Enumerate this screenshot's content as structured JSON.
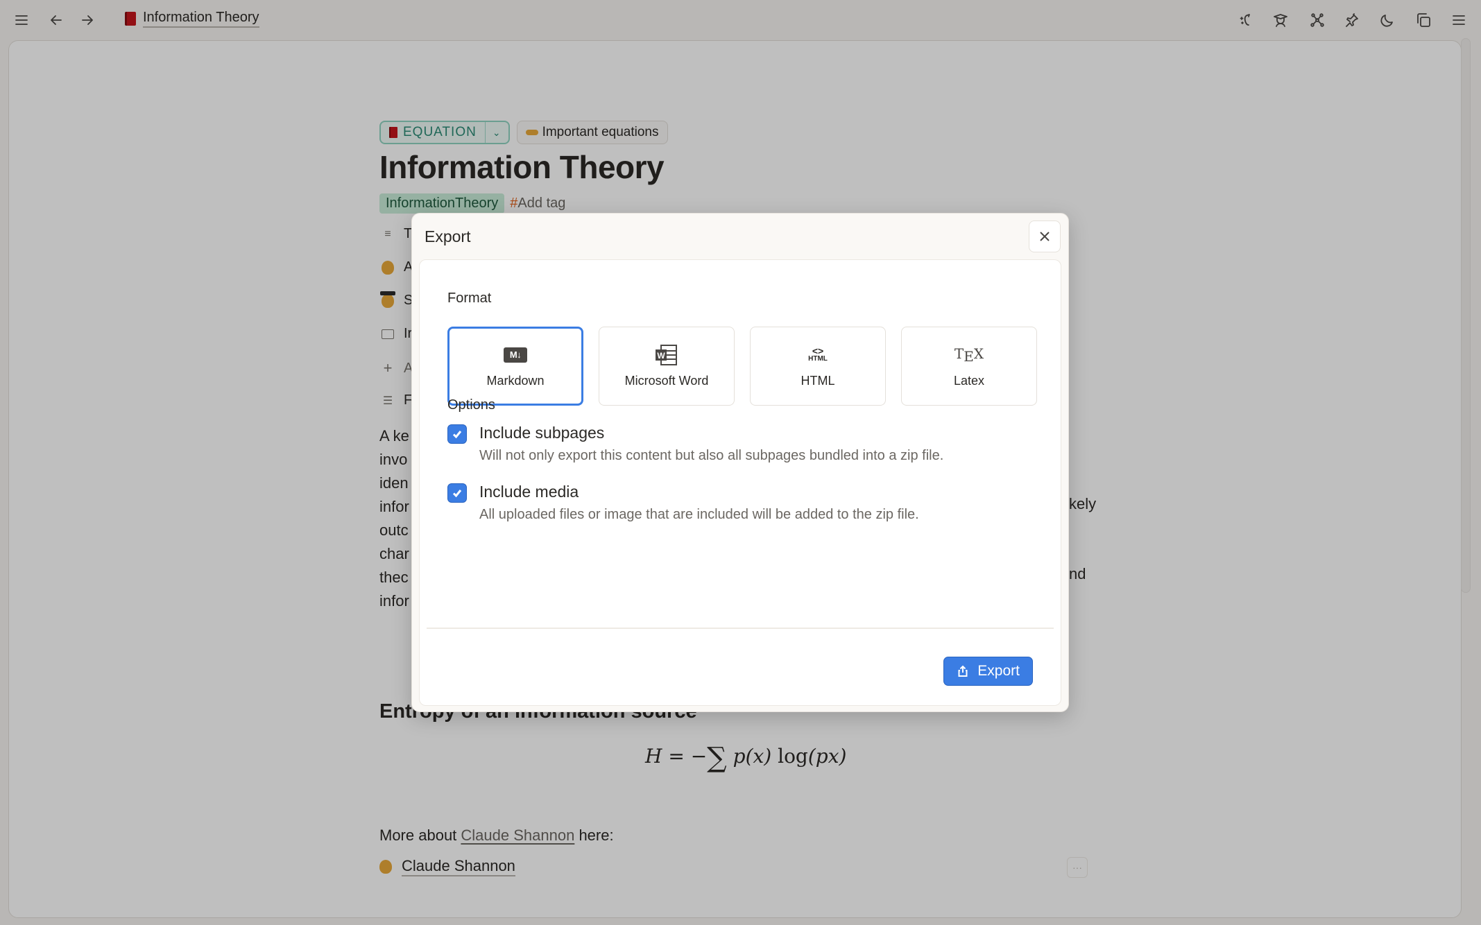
{
  "topbar": {
    "breadcrumb_title": "Information Theory",
    "icons": [
      "menu-icon",
      "back-arrow-icon",
      "forward-arrow-icon",
      "ai-sparkle-icon",
      "student-icon",
      "graph-icon",
      "pin-icon",
      "dark-mode-moon-icon",
      "duplicate-window-icon",
      "more-menu-icon"
    ]
  },
  "document": {
    "type_badge": "EQUATION",
    "collection_badge": "Important equations",
    "title": "Information Theory",
    "tags": [
      "InformationTheory"
    ],
    "add_tag_label": "Add tag",
    "properties": [
      {
        "icon": "text-icon",
        "label_visible": "T"
      },
      {
        "icon": "person-emoji",
        "label_visible": "A"
      },
      {
        "icon": "student-emoji",
        "label_visible": "S"
      },
      {
        "icon": "image-icon",
        "label_visible": "Ir"
      },
      {
        "icon": "plus-icon",
        "label_visible": "A"
      },
      {
        "icon": "list-icon",
        "label_visible": "F"
      }
    ],
    "paragraph_lines_visible": [
      "A ke",
      "invo",
      "iden",
      "infor",
      "outc",
      "char",
      "thec",
      "infor"
    ],
    "paragraph_tail_fragments": [
      "kely",
      "nd"
    ],
    "section_heading": "Entropy of an information source",
    "equation": {
      "lhs": "H",
      "eq": "=",
      "minus": "−",
      "sum": "∑",
      "p_x": "p(x)",
      "log": "log",
      "arg": "(px)"
    },
    "more_prefix": "More about ",
    "more_link": "Claude Shannon",
    "more_suffix": " here:",
    "page_ref": "Claude Shannon",
    "more_dots": "···"
  },
  "dialog": {
    "title": "Export",
    "format_label": "Format",
    "formats": [
      {
        "name": "Markdown",
        "icon_text": "M↓",
        "selected": true
      },
      {
        "name": "Microsoft Word",
        "icon_text": "W",
        "selected": false
      },
      {
        "name": "HTML",
        "icon_text": "HTML",
        "selected": false
      },
      {
        "name": "Latex",
        "icon_text": "TEX",
        "selected": false
      }
    ],
    "options_label": "Options",
    "options": [
      {
        "title": "Include subpages",
        "description": "Will not only export this content but also all subpages bundled into a zip file.",
        "checked": true
      },
      {
        "title": "Include media",
        "description": "All uploaded files or image that are included will be added to the zip file.",
        "checked": true
      }
    ],
    "export_button": "Export"
  },
  "colors": {
    "accent": "#3b7de3",
    "tag_bg": "#c9ecd9",
    "type_badge": "#2a8a74",
    "hash": "#e0631f"
  }
}
